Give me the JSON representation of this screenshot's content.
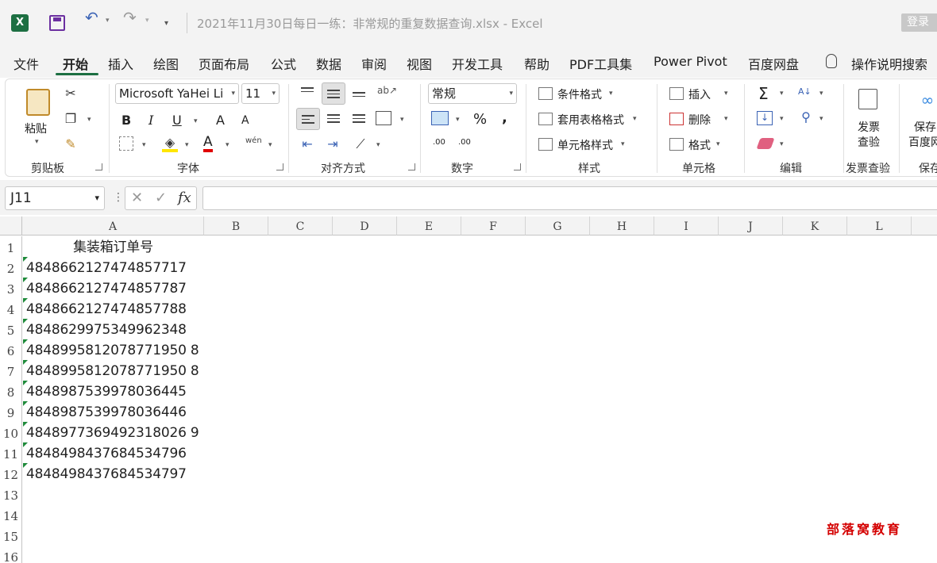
{
  "titlebar": {
    "app_icon": "X",
    "doc_title": "2021年11月30日每日一练：非常规的重复数据查询.xlsx  -  Excel",
    "login": "登录",
    "icons": [
      "excel-logo-icon",
      "save-icon",
      "undo-icon",
      "redo-icon",
      "customize-quick-access-icon"
    ]
  },
  "tabs": [
    {
      "label": "文件"
    },
    {
      "label": "开始",
      "active": true
    },
    {
      "label": "插入"
    },
    {
      "label": "绘图"
    },
    {
      "label": "页面布局"
    },
    {
      "label": "公式"
    },
    {
      "label": "数据"
    },
    {
      "label": "审阅"
    },
    {
      "label": "视图"
    },
    {
      "label": "开发工具"
    },
    {
      "label": "帮助"
    },
    {
      "label": "PDF工具集"
    },
    {
      "label": "Power Pivot"
    },
    {
      "label": "百度网盘"
    }
  ],
  "tell_me": "操作说明搜索",
  "ribbon": {
    "clipboard": {
      "paste": "粘贴",
      "group": "剪贴板"
    },
    "font": {
      "name": "Microsoft YaHei Li",
      "size": "11",
      "group": "字体",
      "bold": "B",
      "italic": "I",
      "underline": "U",
      "grow": "A",
      "shrink": "A",
      "font_color": "A",
      "phonetic": "wén"
    },
    "alignment": {
      "group": "对齐方式"
    },
    "number": {
      "format": "常规",
      "percent": "%",
      "comma": ",",
      "group": "数字",
      "inc_decimal": ".00",
      "dec_decimal": ".00"
    },
    "styles": {
      "conditional": "条件格式",
      "table": "套用表格格式",
      "cell": "单元格样式",
      "group": "样式"
    },
    "cells": {
      "insert": "插入",
      "delete": "删除",
      "format": "格式",
      "group": "单元格"
    },
    "editing": {
      "group": "编辑",
      "sum": "Σ"
    },
    "invoice": {
      "label1": "发票",
      "label2": "查验",
      "group": "发票查验"
    },
    "save": {
      "label1": "保存",
      "label2": "百度网",
      "group": "保存"
    }
  },
  "formula_bar": {
    "name_box": "J11",
    "cancel": "✕",
    "enter": "✓",
    "fx": "fx",
    "dots": "⋮",
    "value": ""
  },
  "grid": {
    "columns": [
      "A",
      "B",
      "C",
      "D",
      "E",
      "F",
      "G",
      "H",
      "I",
      "J",
      "K",
      "L"
    ],
    "rows": [
      "1",
      "2",
      "3",
      "4",
      "5",
      "6",
      "7",
      "8",
      "9",
      "10",
      "11",
      "12",
      "13",
      "14",
      "15",
      "16"
    ],
    "header_cell": "集装箱订单号",
    "values": [
      "4848662127474857717",
      "4848662127474857787",
      "4848662127474857788",
      "4848629975349962348",
      "4848995812078771950 8",
      "4848995812078771950 8",
      "4848987539978036445",
      "4848987539978036446",
      "4848977369492318026 9",
      "4848498437684534796",
      "4848498437684534797"
    ]
  },
  "watermark": "部落窝教育"
}
